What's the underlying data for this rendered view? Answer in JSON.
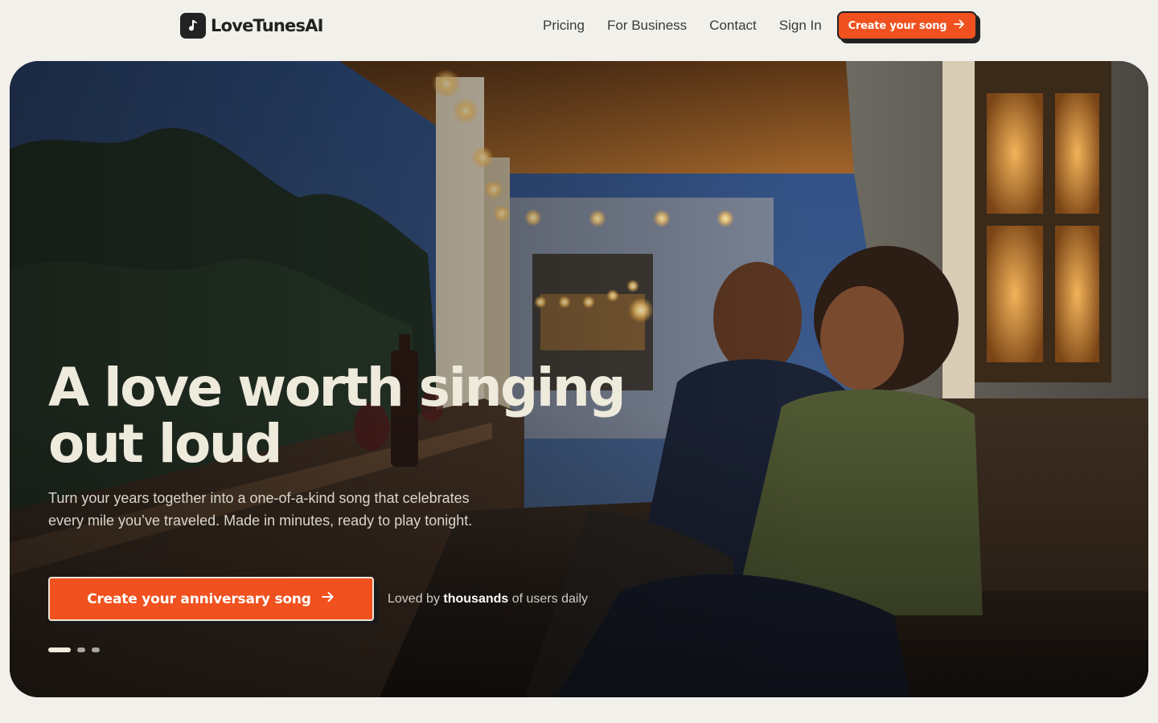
{
  "brand": {
    "name": "LoveTunesAI",
    "logo_icon": "music-note-icon"
  },
  "nav": {
    "items": [
      {
        "label": "Pricing"
      },
      {
        "label": "For Business"
      },
      {
        "label": "Contact"
      },
      {
        "label": "Sign In"
      }
    ],
    "cta_label": "Create your song",
    "cta_icon": "arrow-right-icon"
  },
  "hero": {
    "title_line1": "A love worth singing",
    "title_line2": "out loud",
    "subtitle": "Turn your years together into a one-of-a-kind song that celebrates every mile you’ve traveled. Made in minutes, ready to play tonight.",
    "cta_label": "Create your anniversary song",
    "cta_icon": "arrow-right-icon",
    "social_proof": {
      "prefix": "Loved by",
      "highlight": "thousands",
      "suffix": "of users daily"
    },
    "carousel": {
      "slide_count": 3,
      "active_index": 0
    },
    "image_description_icon": "couple-on-porch-photo"
  },
  "colors": {
    "accent": "#f0511e",
    "page_bg": "#f1f0ea",
    "text_dark": "#222222",
    "hero_title": "#eeeadc"
  }
}
